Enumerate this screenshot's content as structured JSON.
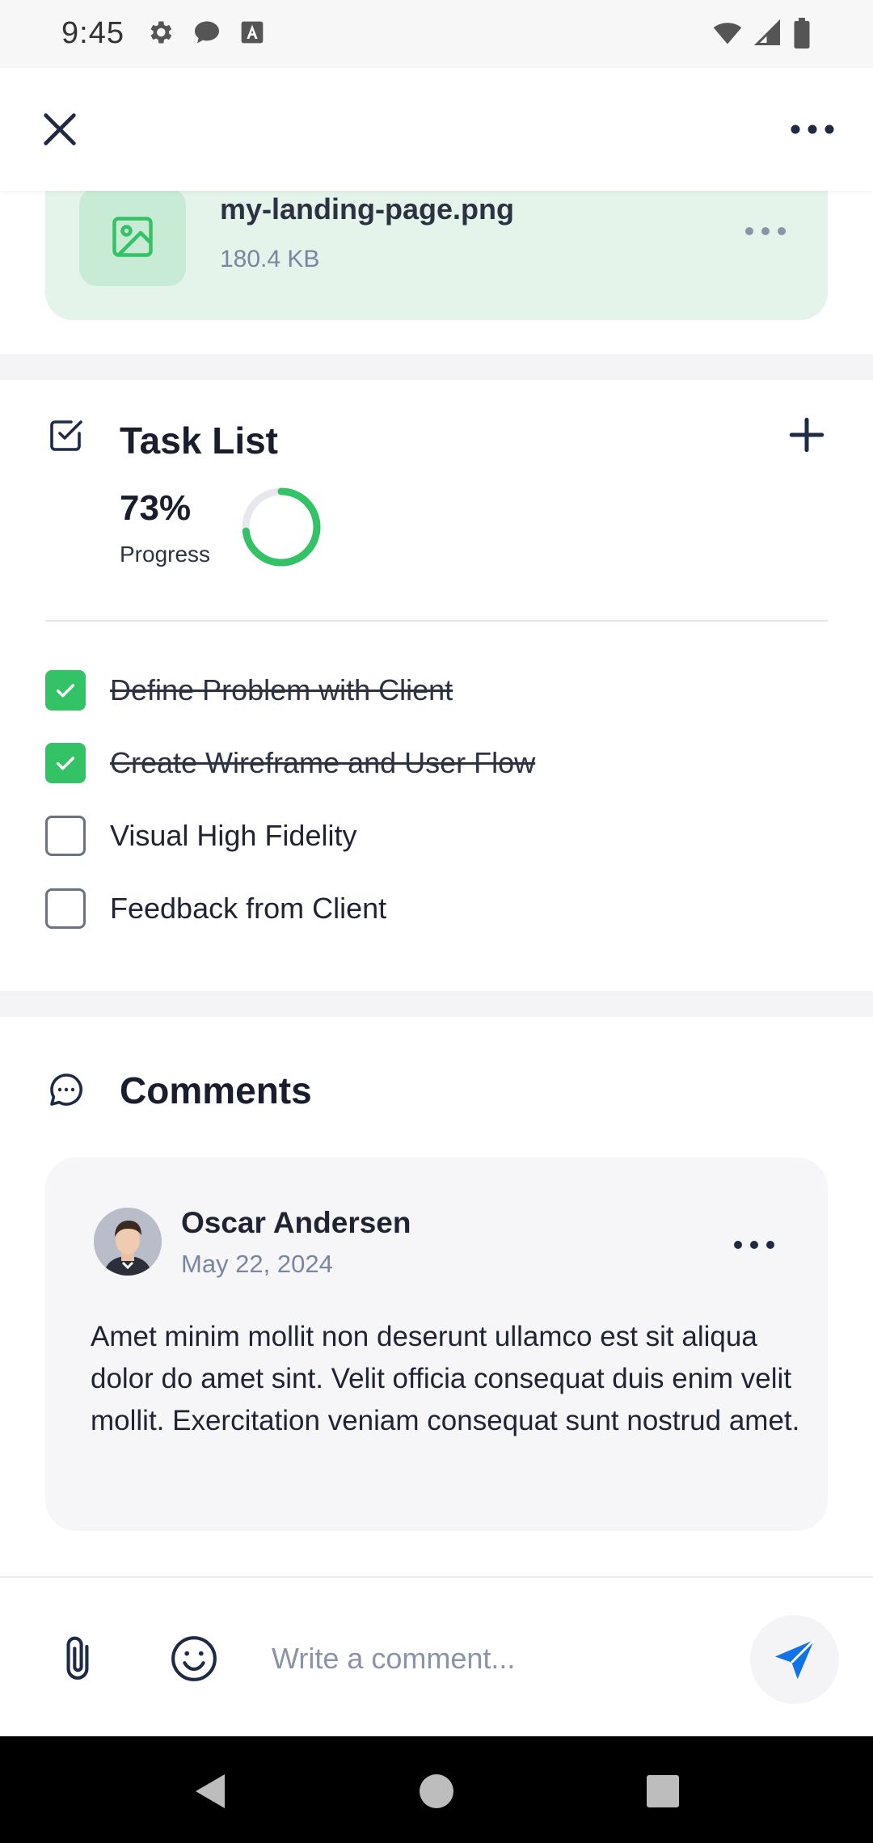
{
  "status_bar": {
    "time": "9:45",
    "left_icons": [
      "gear-icon",
      "chat-bubble-icon",
      "font-a-icon"
    ],
    "right_icons": [
      "wifi-icon",
      "signal-icon",
      "battery-icon"
    ]
  },
  "top_bar": {
    "close_icon": "close-icon",
    "more_icon": "more-horizontal-icon"
  },
  "attachment": {
    "file_name": "my-landing-page.png",
    "file_size": "180.4 KB",
    "thumb_icon": "image-icon"
  },
  "task_list": {
    "title": "Task List",
    "progress_value": "73%",
    "progress_fraction": 0.73,
    "progress_label": "Progress",
    "tasks": [
      {
        "label": "Define Problem with Client",
        "done": true
      },
      {
        "label": "Create Wireframe and User Flow",
        "done": true
      },
      {
        "label": "Visual High Fidelity",
        "done": false
      },
      {
        "label": "Feedback from Client",
        "done": false
      }
    ]
  },
  "comments": {
    "title": "Comments",
    "items": [
      {
        "author": "Oscar Andersen",
        "date": "May 22, 2024",
        "text": "Amet minim mollit non deserunt ullamco est sit aliqua dolor do amet sint. Velit officia consequat duis enim velit mollit. Exercitation veniam consequat sunt nostrud amet."
      }
    ]
  },
  "composer": {
    "placeholder": "Write a comment...",
    "value": ""
  },
  "colors": {
    "accent_green": "#34c266",
    "send_blue": "#1273e8",
    "card_green": "#e4f4ea"
  }
}
